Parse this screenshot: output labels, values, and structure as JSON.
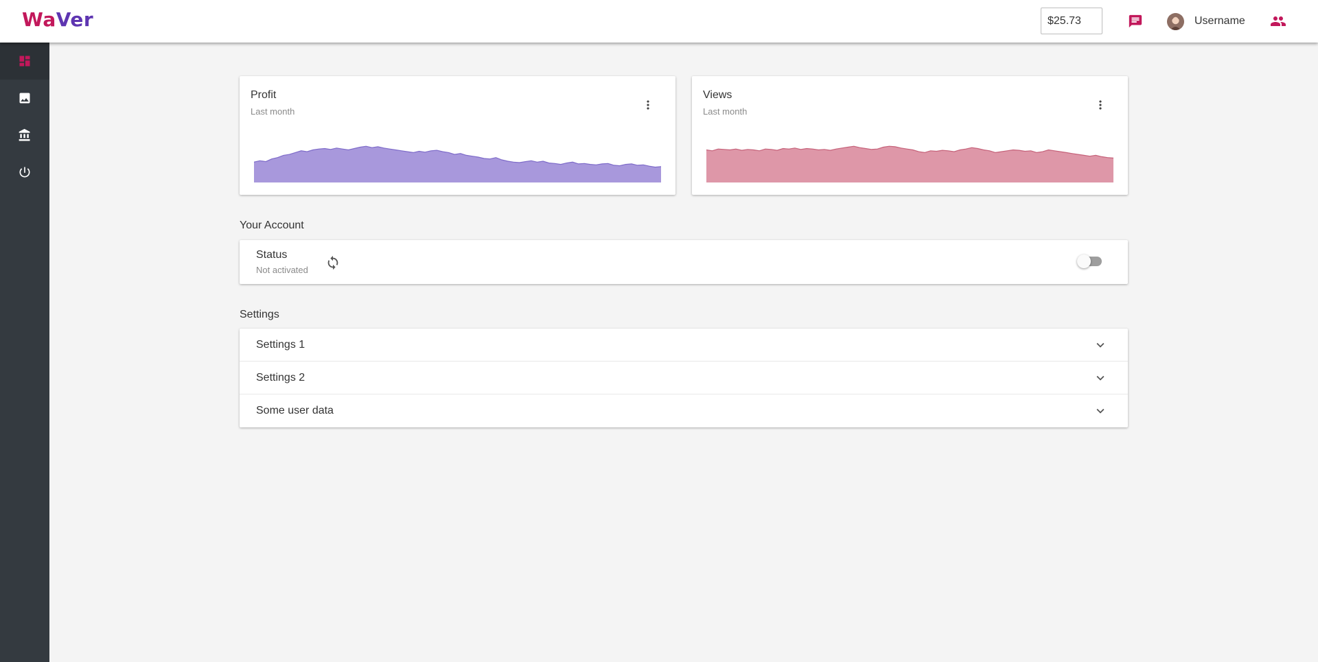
{
  "header": {
    "logo_part1": "Wa",
    "logo_part2": "Ver",
    "balance": "$25.73",
    "username": "Username",
    "icons": [
      "chat-icon",
      "avatar",
      "people-icon"
    ]
  },
  "sidebar": {
    "items": [
      {
        "icon": "dashboard-icon",
        "active": true
      },
      {
        "icon": "image-icon",
        "active": false
      },
      {
        "icon": "bank-icon",
        "active": false
      },
      {
        "icon": "power-icon",
        "active": false
      }
    ]
  },
  "profit_card": {
    "title": "Profit",
    "subtitle": "Last month"
  },
  "views_card": {
    "title": "Views",
    "subtitle": "Last month"
  },
  "account": {
    "section_title": "Your Account",
    "status_label": "Status",
    "status_value": "Not activated",
    "toggle_on": false
  },
  "settings": {
    "section_title": "Settings",
    "panels": [
      {
        "label": "Settings 1"
      },
      {
        "label": "Settings 2"
      },
      {
        "label": "Some user data"
      }
    ]
  },
  "colors": {
    "accent": "#c2185b",
    "brand_purple": "#5e35b1",
    "profit_fill": "#a898dc",
    "profit_line": "#7e6bc9",
    "views_fill": "#de97a8",
    "views_line": "#c56179",
    "sidebar_bg": "#343a40"
  },
  "chart_data": [
    {
      "type": "area",
      "series": [
        {
          "values": [
            45,
            48,
            46,
            52,
            55,
            60,
            62,
            66,
            70,
            68,
            72,
            74,
            75,
            73,
            76,
            74,
            72,
            75,
            78,
            80,
            77,
            79,
            76,
            74,
            72,
            70,
            68,
            66,
            69,
            67,
            70,
            71,
            68,
            66,
            62,
            64,
            60,
            58,
            56,
            53,
            52,
            55,
            50,
            47,
            45,
            44,
            46,
            48,
            45,
            47,
            43,
            42,
            40,
            43,
            45,
            41,
            42,
            40,
            39,
            41,
            42,
            38,
            37,
            40,
            41,
            38,
            39,
            36,
            34,
            35
          ]
        }
      ]
    },
    {
      "type": "area",
      "series": [
        {
          "values": [
            72,
            70,
            74,
            73,
            72,
            74,
            71,
            73,
            72,
            70,
            74,
            73,
            71,
            75,
            74,
            76,
            73,
            75,
            74,
            72,
            73,
            71,
            74,
            76,
            78,
            80,
            77,
            75,
            73,
            74,
            78,
            80,
            79,
            76,
            74,
            72,
            68,
            66,
            70,
            69,
            71,
            70,
            68,
            72,
            74,
            77,
            75,
            72,
            70,
            66,
            68,
            70,
            72,
            71,
            69,
            70,
            66,
            68,
            72,
            70,
            68,
            66,
            64,
            62,
            60,
            58,
            60,
            57,
            55,
            54
          ]
        }
      ]
    }
  ]
}
